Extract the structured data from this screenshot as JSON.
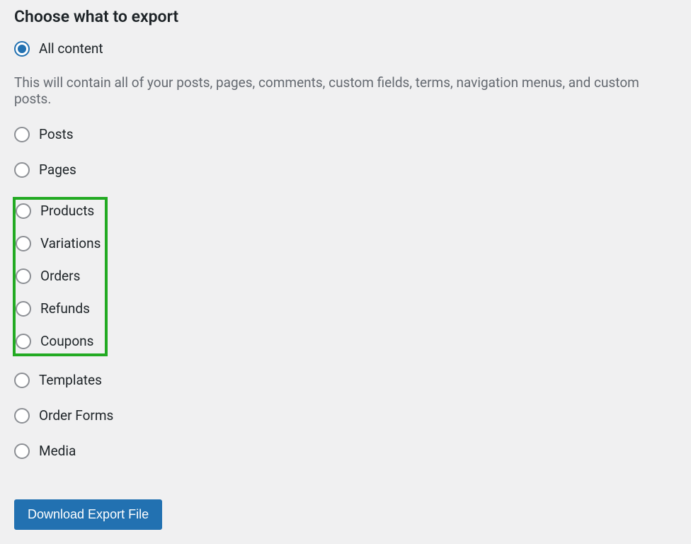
{
  "heading": "Choose what to export",
  "options": {
    "all_content": "All content",
    "description": "This will contain all of your posts, pages, comments, custom fields, terms, navigation menus, and custom posts.",
    "posts": "Posts",
    "pages": "Pages",
    "products": "Products",
    "variations": "Variations",
    "orders": "Orders",
    "refunds": "Refunds",
    "coupons": "Coupons",
    "templates": "Templates",
    "order_forms": "Order Forms",
    "media": "Media"
  },
  "button": "Download Export File"
}
